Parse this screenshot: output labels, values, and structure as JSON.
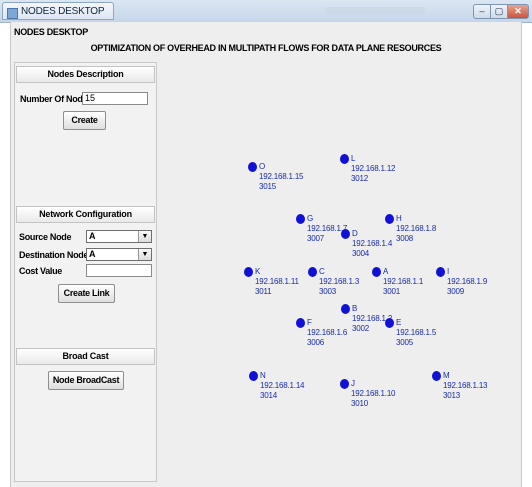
{
  "window": {
    "title": "NODES DESKTOP",
    "minimize": "–",
    "maximize": "▢",
    "close": "✕"
  },
  "menu_label": "NODES DESKTOP",
  "heading": "OPTIMIZATION OF OVERHEAD IN MULTIPATH FLOWS FOR DATA PLANE RESOURCES",
  "nodes_description": {
    "title": "Nodes Description",
    "number_label": "Number Of Nodes",
    "number_value": "15",
    "create_button": "Create"
  },
  "network_configuration": {
    "title": "Network Configuration",
    "source_label": "Source Node",
    "source_value": "A",
    "destination_label": "Destination Node",
    "destination_value": "A",
    "cost_label": "Cost Value",
    "cost_value": "",
    "create_link_button": "Create Link"
  },
  "broadcast": {
    "title": "Broad Cast",
    "button": "Node BroadCast"
  },
  "colors": {
    "node_dot": "#1010d6",
    "node_text": "#1a2bb0"
  },
  "nodes": [
    {
      "name": "O",
      "ip": "192.168.1.15",
      "port": "3015"
    },
    {
      "name": "L",
      "ip": "192.168.1.12",
      "port": "3012"
    },
    {
      "name": "G",
      "ip": "192.168.1.7",
      "port": "3007"
    },
    {
      "name": "D",
      "ip": "192.168.1.4",
      "port": "3004"
    },
    {
      "name": "H",
      "ip": "192.168.1.8",
      "port": "3008"
    },
    {
      "name": "K",
      "ip": "192.168.1.11",
      "port": "3011"
    },
    {
      "name": "C",
      "ip": "192.168.1.3",
      "port": "3003"
    },
    {
      "name": "A",
      "ip": "192.168.1.1",
      "port": "3001"
    },
    {
      "name": "I",
      "ip": "192.168.1.9",
      "port": "3009"
    },
    {
      "name": "B",
      "ip": "192.168.1.2",
      "port": "3002"
    },
    {
      "name": "F",
      "ip": "192.168.1.6",
      "port": "3006"
    },
    {
      "name": "E",
      "ip": "192.168.1.5",
      "port": "3005"
    },
    {
      "name": "N",
      "ip": "192.168.1.14",
      "port": "3014"
    },
    {
      "name": "J",
      "ip": "192.168.1.10",
      "port": "3010"
    },
    {
      "name": "M",
      "ip": "192.168.1.13",
      "port": "3013"
    }
  ]
}
